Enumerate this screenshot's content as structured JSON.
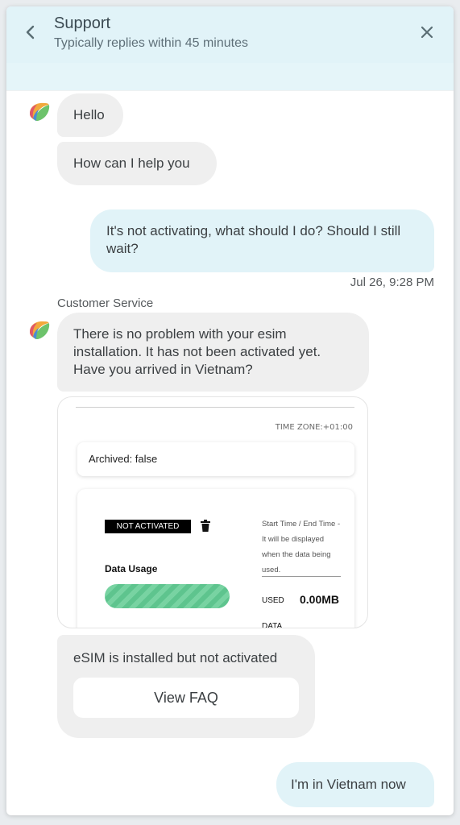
{
  "header": {
    "title": "Support",
    "subtitle": "Typically replies within 45 minutes",
    "back_icon": "chevron-left-icon",
    "close_icon": "close-icon"
  },
  "messages": {
    "hello": "Hello",
    "help": "How can I help you",
    "user_question": "It's not activating, what should I do? Should I still wait?",
    "timestamp": "Jul 26, 9:28 PM",
    "agent_name": "Customer Service",
    "agent_reply": "There is no problem with your esim installation. It has not been activated yet. Have you arrived in Vietnam?",
    "faq_text": "eSIM is installed but not activated",
    "faq_button": "View FAQ",
    "user_reply": "I'm in Vietnam now"
  },
  "screenshot": {
    "timezone": "TIME ZONE:+01:00",
    "archived": "Archived: false",
    "status_badge": "NOT ACTIVATED",
    "data_usage_label": "Data Usage",
    "time_note": "Start Time / End Time - It will be displayed when the data being used.",
    "used_label": "USED",
    "used_value": "0.00MB",
    "data_label": "DATA"
  },
  "colors": {
    "header_bg": "#e1f3f8",
    "incoming_bubble": "#efefef",
    "outgoing_bubble": "#e1f3f8",
    "progress_green": "#5ec48e"
  }
}
